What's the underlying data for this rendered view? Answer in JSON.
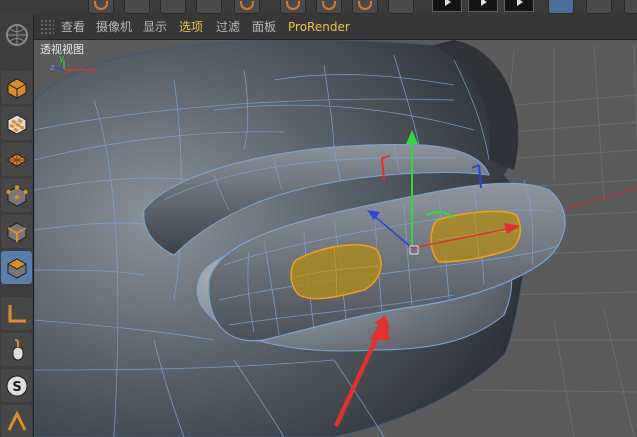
{
  "viewport_menu": {
    "items": [
      {
        "label": "查看",
        "active": false
      },
      {
        "label": "摄像机",
        "active": false
      },
      {
        "label": "显示",
        "active": false
      },
      {
        "label": "选项",
        "active": true
      },
      {
        "label": "过滤",
        "active": false
      },
      {
        "label": "面板",
        "active": false
      },
      {
        "label": "ProRender",
        "active": true
      }
    ]
  },
  "viewport": {
    "label": "透视视图",
    "axis_labels": {
      "x": "x",
      "y": "y",
      "z": "z"
    }
  },
  "left_palette": {
    "tools": [
      {
        "icon": "logo-sphere-icon",
        "active": false
      },
      {
        "icon": "model-mode-icon",
        "active": false
      },
      {
        "icon": "texture-mode-icon",
        "active": false
      },
      {
        "icon": "workplane-mode-icon",
        "active": false
      },
      {
        "icon": "points-mode-icon",
        "active": false
      },
      {
        "icon": "edges-mode-icon",
        "active": false
      },
      {
        "icon": "polygons-mode-icon",
        "active": true
      },
      {
        "icon": "axis-mode-icon",
        "active": false
      },
      {
        "icon": "tweak-mode-icon",
        "active": false
      },
      {
        "icon": "snap-icon",
        "active": false
      },
      {
        "icon": "workplane-lock-icon",
        "active": false
      }
    ]
  },
  "colors": {
    "active_menu": "#e9c24a",
    "active_tool": "#5a7fad",
    "selection_fill": "#a88a22",
    "selection_edge": "#f0a020",
    "axis_x": "#e03030",
    "axis_y": "#2fd840",
    "axis_z": "#2a45d8",
    "annotation_arrow": "#e03030"
  }
}
